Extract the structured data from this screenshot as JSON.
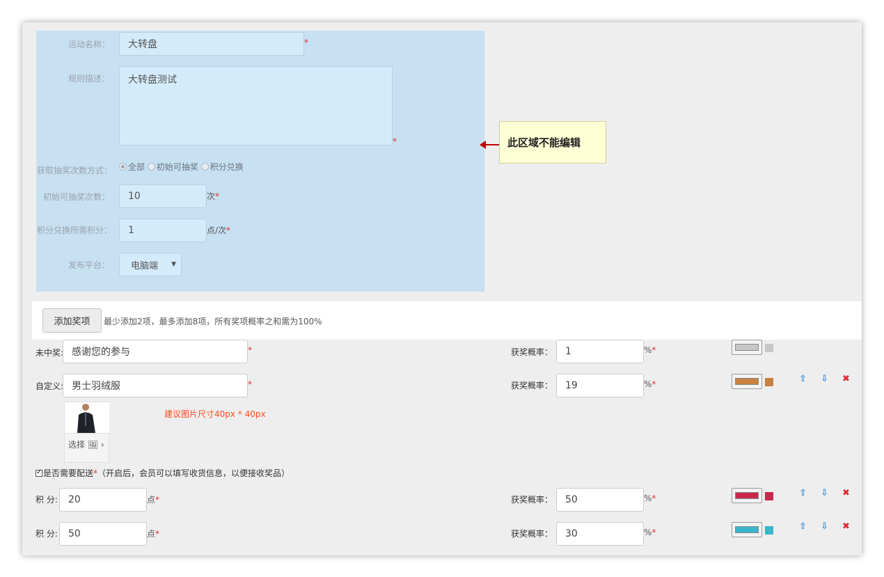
{
  "locked_form": {
    "name_label": "活动名称：",
    "name_value": "大转盘",
    "desc_label": "规则描述：",
    "desc_value": "大转盘测试",
    "mode_label": "获取抽奖次数方式：",
    "mode_options": [
      "全部",
      "初始可抽奖",
      "积分兑换"
    ],
    "initial_label": "初始可抽奖次数：",
    "initial_value": "10",
    "initial_unit": "次",
    "points_label": "积分兑换所需积分：",
    "points_value": "1",
    "points_unit": "点/次",
    "platform_label": "发布平台：",
    "platform_value": "电脑端",
    "required_mark": "*"
  },
  "tooltip": {
    "text": "此区域不能编辑"
  },
  "toolbar": {
    "add_button": "添加奖项",
    "hint": "最少添加2项，最多添加8项，所有奖项概率之和需为100%"
  },
  "prob_label": "获奖概率：",
  "percent_unit": "%",
  "prizes": [
    {
      "label": "未中奖:",
      "value": "感谢您的参与",
      "prob": "1",
      "color": "#c8c8c8"
    },
    {
      "label": "自定义:",
      "value": "男士羽绒服",
      "prob": "19",
      "color": "#c98040"
    },
    {
      "label": "积 分:",
      "value": "20",
      "unit": "点",
      "prob": "50",
      "color": "#c8294b"
    },
    {
      "label": "积 分:",
      "value": "50",
      "unit": "点",
      "prob": "30",
      "color": "#3ab5cc"
    }
  ],
  "image_hint": "建议图片尺寸40px * 40px",
  "choose_label": "选择",
  "delivery": {
    "label": "是否需要配送",
    "note": "（开启后，会员可以填写收货信息，以便接收奖品）"
  }
}
